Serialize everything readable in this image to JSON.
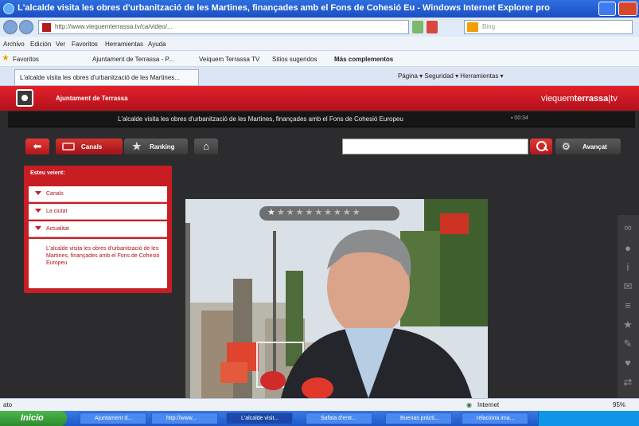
{
  "window": {
    "title": "L'alcalde visita les obres d'urbanització de les Martines, finançades amb el Fons de Cohesió Eu - Windows Internet Explorer pro"
  },
  "address": {
    "url": "http://www.viequemterrassa.tv/ca/video/...",
    "search_placeholder": "Bing"
  },
  "menu": [
    "Archivo",
    "Edición",
    "Ver",
    "Favoritos",
    "Herramientas",
    "Ayuda"
  ],
  "favorites": {
    "label": "Favoritos",
    "items": [
      "Ajuntament de Terrassa - P...",
      "Veiquem Terrassa TV",
      "Sitios sugeridos",
      "Más complementos"
    ]
  },
  "tab": {
    "label": "L'alcalde visita les obres d'urbanització de les Martines...",
    "tools": "Página ▾  Seguridad ▾  Herramientas ▾"
  },
  "site": {
    "org": "Ajuntament de Terrassa",
    "brand_light": "viequem",
    "brand_bold": "terrassa",
    "brand_suffix": "tv",
    "headline": "L'alcalde visita les obres d'urbanització de les Martines, finançades amb el Fons de Cohesió Europeu",
    "headline_meta": "▪ 00:34"
  },
  "toolbar": {
    "canals": "Canals",
    "ranking": "Ranking",
    "advanced": "Avançat"
  },
  "panel": {
    "title": "Esteu veient:",
    "items": [
      "Canals",
      "La ciutat",
      "Actualitat"
    ],
    "article": "L'alcalde visita les obres d'urbanització de les Martines, finançades amb el Fons de Cohesió Europeu"
  },
  "rating": {
    "first_star": "★",
    "stars": "★★★★★★★★★"
  },
  "status": {
    "left": "ato",
    "zone": "Internet",
    "zoom": "95%"
  },
  "taskbar": {
    "start": "Inicio",
    "tasks": [
      "Ajuntament d...",
      "http://www...",
      "L'alcalde visit...",
      "Safata d'entr...",
      "Buenas prácti...",
      "relaciona ima..."
    ]
  },
  "colors": {
    "brand_red": "#c81d23",
    "site_bg": "#2c2c2e"
  }
}
